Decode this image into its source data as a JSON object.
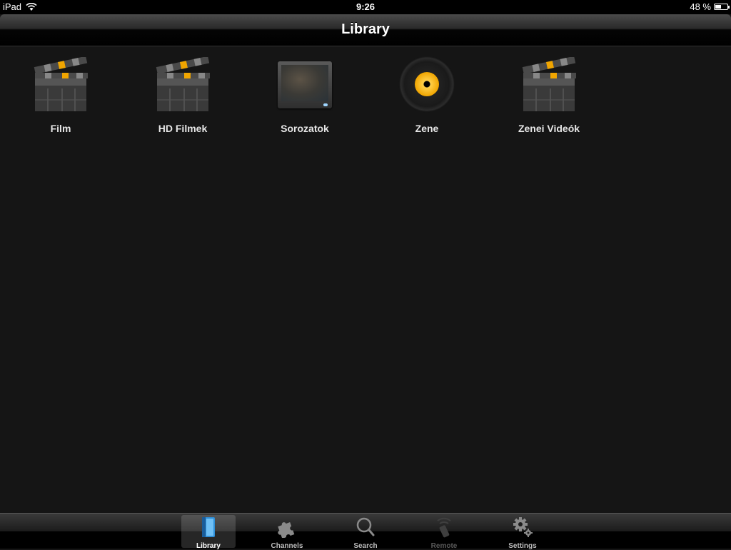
{
  "status_bar": {
    "device": "iPad",
    "time": "9:26",
    "battery": "48 %",
    "battery_level": 0.48
  },
  "nav": {
    "title": "Library"
  },
  "library": {
    "items": [
      {
        "label": "Film",
        "icon": "clapperboard-icon"
      },
      {
        "label": "HD Filmek",
        "icon": "clapperboard-icon"
      },
      {
        "label": "Sorozatok",
        "icon": "tv-icon"
      },
      {
        "label": "Zene",
        "icon": "vinyl-record-icon"
      },
      {
        "label": "Zenei Videók",
        "icon": "clapperboard-icon"
      }
    ]
  },
  "tabbar": {
    "tabs": [
      {
        "label": "Library",
        "icon": "book-icon",
        "state": "selected"
      },
      {
        "label": "Channels",
        "icon": "puzzle-icon",
        "state": "normal"
      },
      {
        "label": "Search",
        "icon": "magnifier-icon",
        "state": "normal"
      },
      {
        "label": "Remote",
        "icon": "remote-icon",
        "state": "disabled"
      },
      {
        "label": "Settings",
        "icon": "gears-icon",
        "state": "normal"
      }
    ]
  },
  "colors": {
    "background": "#151515",
    "accent_orange": "#f0a500",
    "label": "#e6e6e6"
  }
}
